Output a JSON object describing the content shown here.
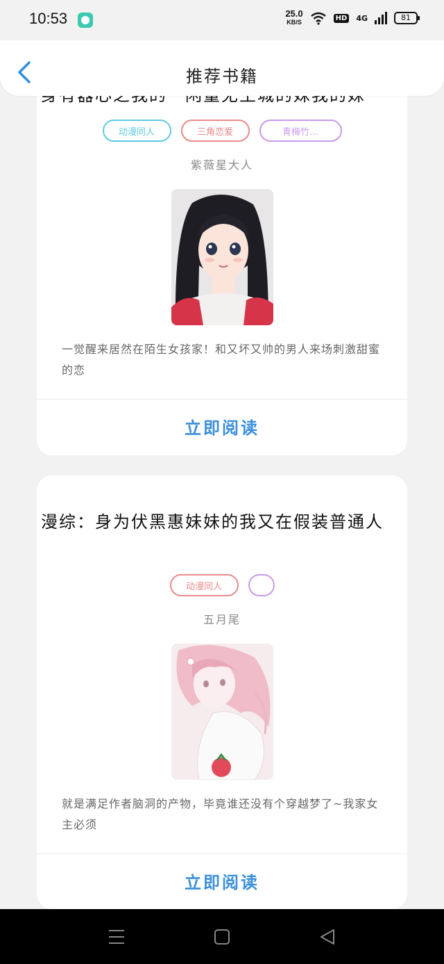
{
  "status_bar": {
    "time": "10:53",
    "net_speed": "25.0",
    "net_unit": "KB/S",
    "hd": "HD",
    "signal": "4G",
    "battery": "81",
    "icons": [
      "app-notification-icon",
      "wifi-icon",
      "signal-icon",
      "battery-icon"
    ]
  },
  "header": {
    "title": "推荐书籍",
    "back_icon": "chevron-left-icon",
    "accent": "#2f8fe0"
  },
  "books": [
    {
      "title": "身有器心之我的一闲量无王城的妹我的妹",
      "tags": [
        {
          "label": "动漫同人",
          "color": "#5fc9df"
        },
        {
          "label": "三角恋爱",
          "color": "#ea8a8a"
        },
        {
          "label": "青梅竹…",
          "color": "#c99be8"
        }
      ],
      "author": "紫薇星大人",
      "description": "一觉醒来居然在陌生女孩家！和又坏又帅的男人来场刺激甜蜜的恋",
      "read_label": "立即阅读"
    },
    {
      "title": "漫综：身为伏黑惠妹妹的我又在假装普通人",
      "tags": [
        {
          "label": "动漫同人",
          "color": "#ea8a8a"
        },
        {
          "label": "",
          "color": "#c99be8"
        }
      ],
      "author": "五月尾",
      "description": "就是满足作者脑洞的产物，毕竟谁还没有个穿越梦了~我家女主必须",
      "read_label": "立即阅读"
    }
  ],
  "nav_bar": {
    "icons": [
      "menu-icon",
      "home-square-icon",
      "back-triangle-icon"
    ]
  }
}
